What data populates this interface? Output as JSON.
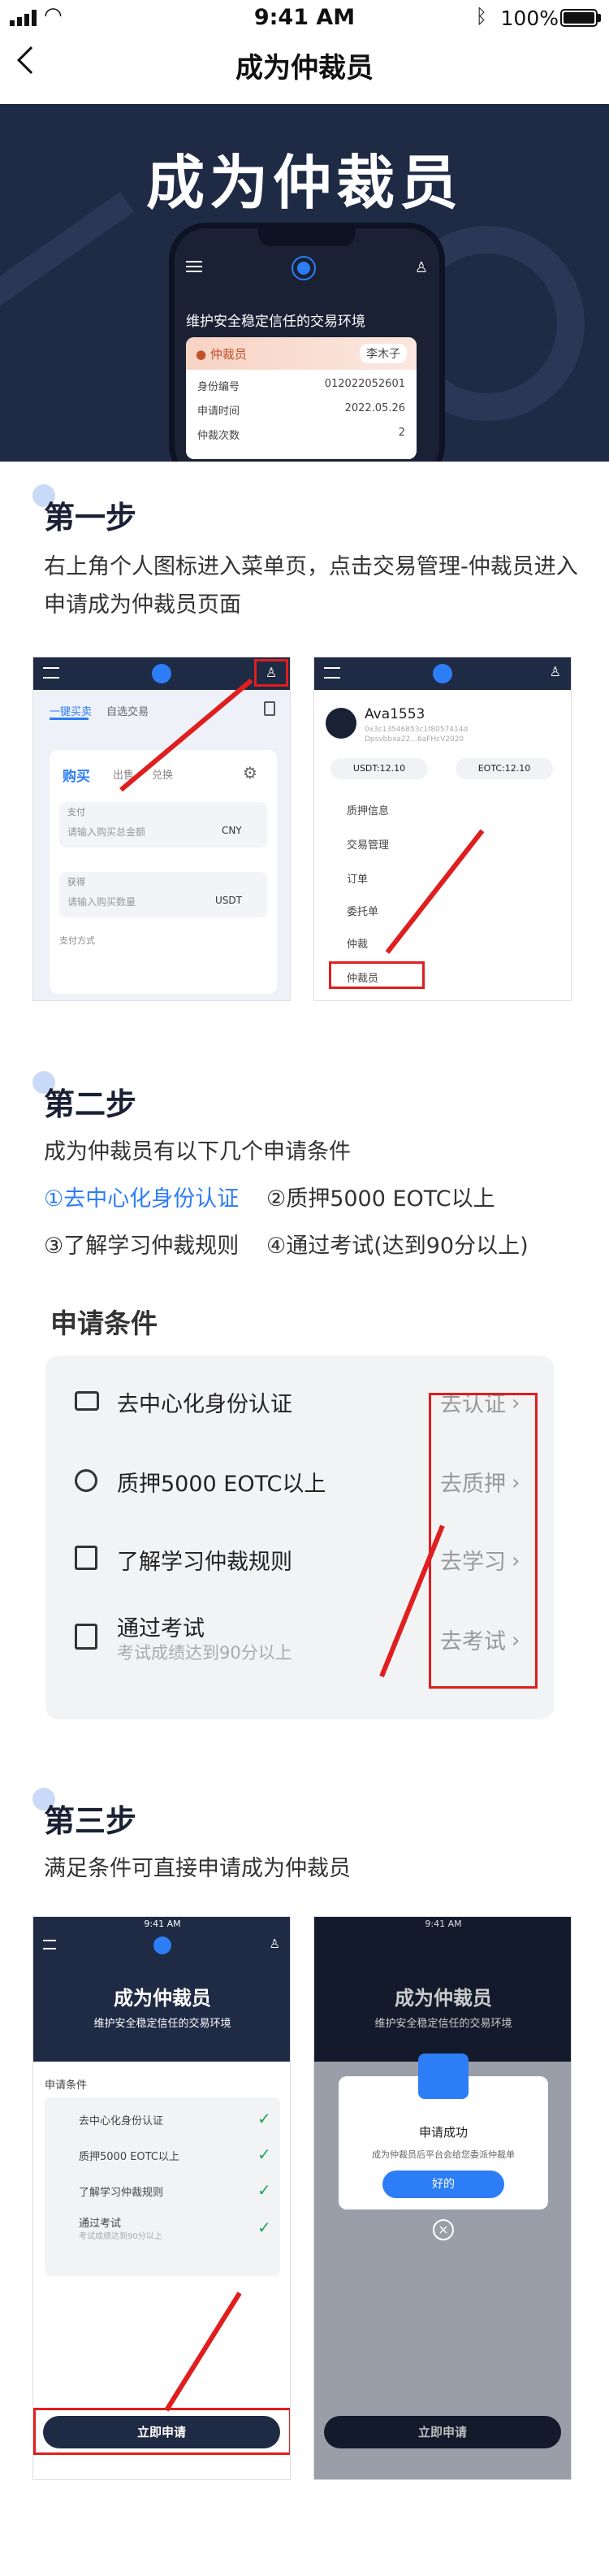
{
  "status_bar": {
    "time": "9:41 AM",
    "battery": "100%"
  },
  "nav": {
    "title": "成为仲裁员"
  },
  "hero": {
    "title": "成为仲裁员",
    "phone_subtitle": "维护安全稳定信任的交易环境",
    "card_tag": "仲裁员",
    "card_name": "李木子",
    "rows": [
      {
        "label": "身份编号",
        "value": "012022052601"
      },
      {
        "label": "申请时间",
        "value": "2022.05.26"
      },
      {
        "label": "仲裁次数",
        "value": "2"
      }
    ]
  },
  "step1": {
    "title": "第一步",
    "text": "右上角个人图标进入菜单页，点击交易管理-仲裁员进入申请成为仲裁员页面",
    "mock_left": {
      "tabs": [
        "一键买卖",
        "自选交易"
      ],
      "buy_tabs": [
        "购买",
        "出售",
        "兑换"
      ],
      "pay_label": "支付",
      "pay_placeholder": "请输入购买总金额",
      "pay_currency": "CNY",
      "get_label": "获得",
      "get_placeholder": "请输入购买数量",
      "get_currency": "USDT",
      "pay_method": "支付方式"
    },
    "mock_right": {
      "user": "Ava1553",
      "addr1": "0x3c13546853c1f8057414d",
      "addr2": "Dpsvbbxa22...6aFHcV2020",
      "usdt": "USDT:12.10",
      "eotc": "EOTC:12.10",
      "menu": [
        "质押信息",
        "交易管理",
        "订单",
        "委托单",
        "仲裁",
        "仲裁员"
      ]
    }
  },
  "step2": {
    "title": "第二步",
    "intro": "成为仲裁员有以下几个申请条件",
    "c1": "①去中心化身份认证",
    "c2": "②质押5000 EOTC以上",
    "c3": "③了解学习仲裁规则",
    "c4": "④通过考试(达到90分以上)",
    "panel_title": "申请条件",
    "items": [
      {
        "label": "去中心化身份认证",
        "action": "去认证"
      },
      {
        "label": "质押5000 EOTC以上",
        "action": "去质押"
      },
      {
        "label": "了解学习仲裁规则",
        "action": "去学习"
      },
      {
        "label": "通过考试",
        "sub": "考试成绩达到90分以上",
        "action": "去考试"
      }
    ]
  },
  "step3": {
    "title": "第三步",
    "text": "满足条件可直接申请成为仲裁员",
    "mock_time": "9:41 AM",
    "mock_title": "成为仲裁员",
    "mock_sub": "维护安全稳定信任的交易环境",
    "cond_header": "申请条件",
    "items": [
      "去中心化身份认证",
      "质押5000 EOTC以上",
      "了解学习仲裁规则",
      "通过考试"
    ],
    "exam_sub": "考试成绩达到90分以上",
    "apply_button": "立即申请",
    "success_title": "申请成功",
    "success_text": "成为仲裁员后平台会给您委派仲裁单",
    "ok_button": "好的"
  }
}
